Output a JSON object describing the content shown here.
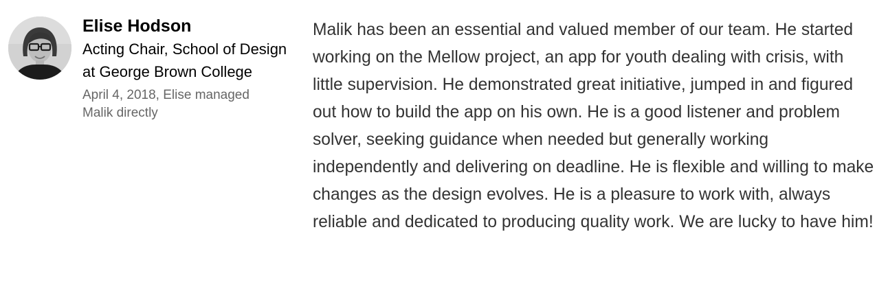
{
  "recommender": {
    "name": "Elise Hodson",
    "headline": "Acting Chair, School of Design at George Brown College",
    "relation": "April 4, 2018, Elise managed Malik directly"
  },
  "recommendation": {
    "text": "Malik has been an essential and valued member of our team. He started working on the Mellow project, an app for youth dealing with crisis, with little supervision. He demonstrated great initiative, jumped in and figured out how to build the app on his own. He is a good listener and problem solver, seeking guidance when needed but generally working independently and delivering on deadline. He is flexible and willing to make changes as the design evolves. He is a pleasure to work with, always reliable and dedicated to producing quality work. We are lucky to have him!"
  },
  "colors": {
    "name": "#000000",
    "headline": "#000000",
    "relation": "#666666",
    "body": "#333333",
    "avatar_background": "#cfcfcf"
  }
}
